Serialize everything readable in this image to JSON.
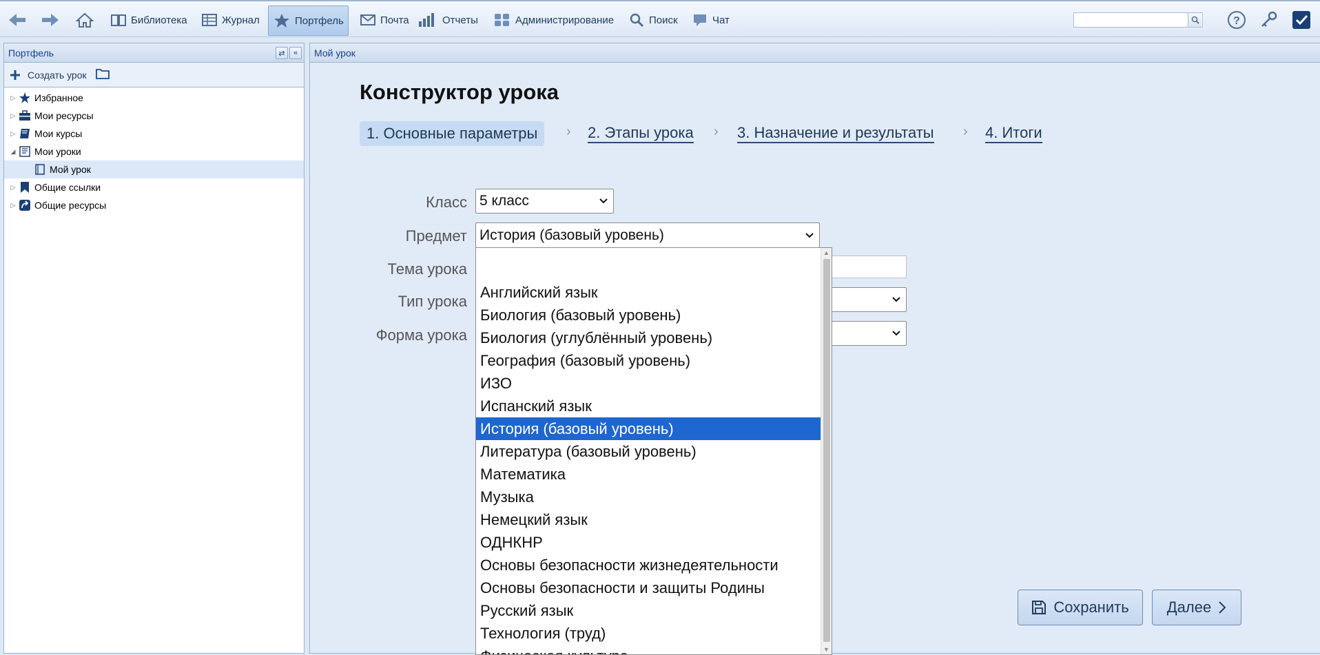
{
  "toolbar": {
    "library": "Библиотека",
    "journal": "Журнал",
    "portfolio": "Портфель",
    "mail": "Почта",
    "reports": "Отчеты",
    "admin": "Администрирование",
    "search": "Поиск",
    "chat": "Чат",
    "search_value": ""
  },
  "left_panel": {
    "title": "Портфель",
    "create_label": "Создать урок",
    "tree": [
      {
        "label": "Избранное"
      },
      {
        "label": "Мои ресурсы"
      },
      {
        "label": "Мои курсы"
      },
      {
        "label": "Мои уроки"
      },
      {
        "label": "Мой урок"
      },
      {
        "label": "Общие ссылки"
      },
      {
        "label": "Общие ресурсы"
      }
    ]
  },
  "main": {
    "panel_title": "Мой урок",
    "page_title": "Конструктор урока",
    "steps": [
      {
        "label": "1. Основные параметры"
      },
      {
        "label": "2. Этапы урока"
      },
      {
        "label": "3. Назначение и результаты"
      },
      {
        "label": "4. Итоги"
      }
    ],
    "form": {
      "class_label": "Класс",
      "class_value": "5 класс",
      "subject_label": "Предмет",
      "subject_value": "История (базовый уровень)",
      "topic_label": "Тема урока",
      "type_label": "Тип урока",
      "form_label": "Форма урока"
    },
    "subject_options": [
      "",
      "Английский язык",
      "Биология (базовый уровень)",
      "Биология (углублённый уровень)",
      "География (базовый уровень)",
      "ИЗО",
      "Испанский язык",
      "История (базовый уровень)",
      "Литература (базовый уровень)",
      "Математика",
      "Музыка",
      "Немецкий язык",
      "ОДНКНР",
      "Основы безопасности жизнедеятельности",
      "Основы безопасности и защиты Родины",
      "Русский язык",
      "Технология (труд)",
      "Физическая культура"
    ],
    "selected_option_index": 7,
    "save_label": "Сохранить",
    "next_label": "Далее"
  }
}
